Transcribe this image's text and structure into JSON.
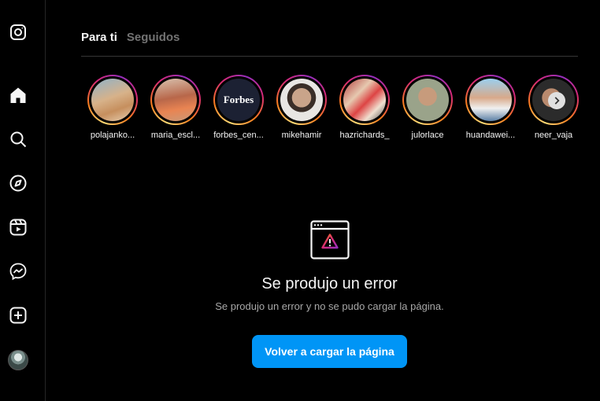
{
  "tabs": [
    {
      "label": "Para ti"
    },
    {
      "label": "Seguidos"
    }
  ],
  "stories": [
    {
      "username": "polajanko..."
    },
    {
      "username": "maria_escl..."
    },
    {
      "username": "forbes_cen...",
      "logo_text": "Forbes"
    },
    {
      "username": "mikehamir"
    },
    {
      "username": "hazrichards_"
    },
    {
      "username": "julorlace"
    },
    {
      "username": "huandawei..."
    },
    {
      "username": "neer_vaja"
    }
  ],
  "error": {
    "title": "Se produjo un error",
    "message": "Se produjo un error y no se pudo cargar la página.",
    "reload_label": "Volver a cargar la página"
  },
  "colors": {
    "background": "#000000",
    "accent": "#0095f6",
    "muted": "#737373",
    "divider": "#363636"
  },
  "icons": {
    "sidebar": [
      "instagram-logo-icon",
      "home-icon",
      "search-icon",
      "explore-icon",
      "reels-icon",
      "messenger-icon",
      "create-icon",
      "profile-avatar"
    ]
  }
}
